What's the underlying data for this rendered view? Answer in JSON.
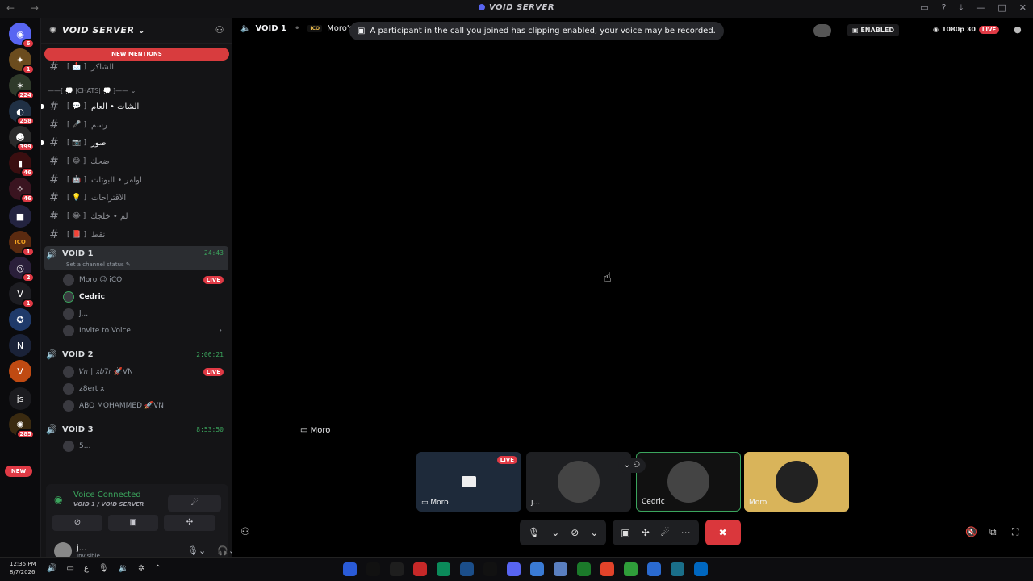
{
  "window": {
    "title": "VOID SERVER",
    "nav": "← →",
    "icons": [
      "inbox-icon",
      "help-icon",
      "download-icon",
      "minimize-icon",
      "maximize-icon",
      "close-icon"
    ]
  },
  "servers": {
    "items": [
      {
        "name": "discord-home",
        "glyph": "◉",
        "badge": "6",
        "color": "#5865f2"
      },
      {
        "name": "server-1",
        "glyph": "✦",
        "badge": "1",
        "color": "#6b4c1e"
      },
      {
        "name": "server-2",
        "glyph": "✶",
        "badge": "224",
        "color": "#2f3a2a"
      },
      {
        "name": "server-3",
        "glyph": "◐",
        "badge": "258",
        "color": "#203044"
      },
      {
        "name": "server-4",
        "glyph": "☻",
        "badge": "399",
        "color": "#2a2a2a"
      },
      {
        "name": "server-5",
        "glyph": "▮",
        "badge": "46",
        "color": "#3a0e10"
      },
      {
        "name": "server-6",
        "glyph": "✧",
        "badge": "46",
        "color": "#3a1420"
      },
      {
        "name": "folder",
        "glyph": "■",
        "badge": "",
        "color": "#232340"
      },
      {
        "name": "server-icon",
        "glyph": "ICO",
        "badge": "1",
        "color": "#5a2a10"
      },
      {
        "name": "server-8",
        "glyph": "◎",
        "badge": "2",
        "color": "#2a1f3a"
      },
      {
        "name": "server-9",
        "glyph": "V",
        "badge": "1",
        "color": "#1d1d22"
      },
      {
        "name": "server-10",
        "glyph": "✪",
        "badge": "",
        "color": "#1f3a6a"
      },
      {
        "name": "server-11",
        "glyph": "N",
        "badge": "",
        "color": "#1a2238"
      },
      {
        "name": "server-12",
        "glyph": "V",
        "badge": "",
        "color": "#c04a12"
      },
      {
        "name": "server-js",
        "glyph": "js",
        "badge": "",
        "color": "#1b1b1f"
      },
      {
        "name": "server-14",
        "glyph": "✺",
        "badge": "285",
        "color": "#3a2a10"
      }
    ],
    "new_label": "NEW"
  },
  "channels": {
    "server_name": "VOID SERVER",
    "new_mentions": "NEW MENTIONS",
    "category": "——[ 💭 |CHATS| 💭 ]—— ⌄",
    "text": [
      {
        "emoji": "📩",
        "name": "الشاكر",
        "bright": false,
        "unread": false
      },
      {
        "emoji": "💬",
        "name": "الشات • العام",
        "bright": true,
        "unread": true
      },
      {
        "emoji": "🎤",
        "name": "رسم",
        "bright": false,
        "unread": false
      },
      {
        "emoji": "📷",
        "name": "صور",
        "bright": true,
        "unread": true
      },
      {
        "emoji": "😂",
        "name": "ضحك",
        "bright": false,
        "unread": false
      },
      {
        "emoji": "🤖",
        "name": "اوامر • البوتات",
        "bright": false,
        "unread": false
      },
      {
        "emoji": "💡",
        "name": "الاقتراحات",
        "bright": false,
        "unread": false
      },
      {
        "emoji": "😂",
        "name": "لم • خلجك",
        "bright": false,
        "unread": false
      },
      {
        "emoji": "📕",
        "name": "نقط",
        "bright": false,
        "unread": false
      }
    ],
    "voice": [
      {
        "name": "VOID 1",
        "time": "24:43",
        "status": "Set a channel status ✎",
        "users": [
          {
            "name": "Moro 😉 iCO",
            "live": true
          },
          {
            "name": "Cedric",
            "live": false
          },
          {
            "name": "j...",
            "live": false
          },
          {
            "name": "Invite to Voice",
            "live": false
          }
        ]
      },
      {
        "name": "VOID 2",
        "time": "2:06:21",
        "users": [
          {
            "name": "𝑉𝑛 ∣ 𝑥𝑏7𝑟 🚀VN",
            "live": true
          },
          {
            "name": "z8ert x",
            "live": false
          },
          {
            "name": "ABO MOHAMMED 🚀VN",
            "live": false
          }
        ]
      },
      {
        "name": "VOID 3",
        "time": "8:53:50",
        "users": [
          {
            "name": "5...",
            "live": false
          }
        ]
      }
    ],
    "live_label": "LIVE"
  },
  "voice_panel": {
    "status": "Voice Connected",
    "location": "VOID 1 / VOID SERVER",
    "user_name": "j...",
    "user_status": "Invisible"
  },
  "stage": {
    "channel": "VOID 1",
    "streamer": "Moro's S",
    "toast": "A participant in the call you joined has clipping enabled, your voice may be recorded.",
    "clips": "ENABLED",
    "quality": "1080p 30",
    "live": "LIVE",
    "stream_label": "Moro",
    "tiles": [
      {
        "name": "Moro",
        "live": true,
        "bg": "#1e2a3a"
      },
      {
        "name": "j...",
        "live": false,
        "bg": "#1e1f22"
      },
      {
        "name": "Cedric",
        "live": false,
        "bg": "#111"
      },
      {
        "name": "Moro",
        "live": false,
        "bg": "#d9b45a"
      }
    ]
  },
  "taskbar": {
    "time": "12:35 PM",
    "date": "8/7/2026",
    "lang": "ع",
    "apps": [
      "#2a5bd7",
      "#111",
      "#1e1e1e",
      "#c62828",
      "#0b8a5a",
      "#1b4e8a",
      "#111",
      "#5865f2",
      "#3a7bd5",
      "#5a7fc0",
      "#1b7a2a",
      "#e2432a",
      "#2f9e3a",
      "#2a6ad0",
      "#1a6f8a",
      "#0067c0"
    ]
  }
}
